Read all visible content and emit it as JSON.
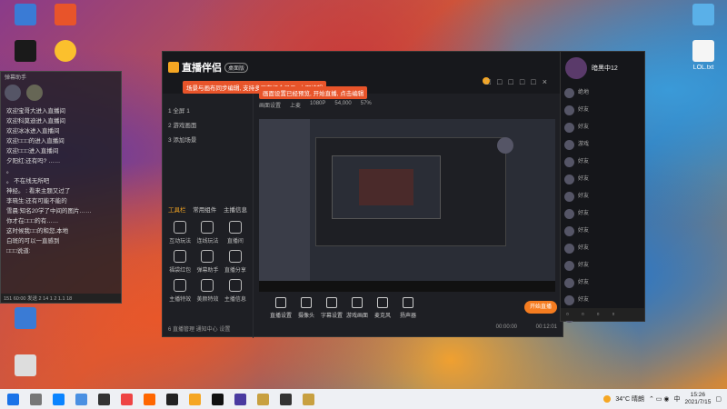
{
  "desktop_icons": [
    {
      "label": "",
      "color": "#3a7bd5"
    },
    {
      "label": "",
      "color": "#e8542a"
    },
    {
      "label": "",
      "color": "#1a1a1a"
    },
    {
      "label": "",
      "color": "#fbc02d"
    },
    {
      "label": "",
      "color": "#888"
    },
    {
      "label": "LOL.txt",
      "color": "#f5f5f5"
    }
  ],
  "chat": {
    "header": "弹幕助手",
    "messages": [
      "欢迎宝哥大进入直播间",
      "欢迎科莫迪进入直播间",
      "欢迎冰冰进入直播间",
      "欢迎□□□的进入直播间",
      "欢迎□□□进入直播间",
      "夕阳红:还有吗? ……",
      "。",
      "。 不在线无所吧",
      "神经。 : 看来主题又过了",
      "李晓生:还有可能不能的",
      "雪晨:知名20学了中间的图片……",
      "你才在□□□的有……",
      "这时候我□□的和您,本地",
      "白斑的可以一直感到",
      "□□□说道:"
    ],
    "footer": "151 60:00 发送 2 14 1 2 1.1 18"
  },
  "app": {
    "title": "直播伴侣",
    "edition": "桌面版",
    "tip1": "场景与画布同步编辑, 支持多画布组合显示, 立即编辑",
    "tip2": "画面设置已经预览, 开始直播, 点击编辑",
    "side_rows": [
      "1 全屏 1",
      "2 游戏画面",
      "3 添加场景"
    ],
    "tabs": [
      "工具栏",
      "常用组件",
      "主播信息"
    ],
    "tools": [
      "互动玩法",
      "连线玩法",
      "直播间",
      "福袋红包",
      "弹幕助手",
      "直播分享",
      "主播特效",
      "美颜特效",
      "主播信息"
    ],
    "bottom_note": "6 直播管理 通知中心 设置",
    "preview_header": [
      "画面设置",
      "上麦",
      "1080P",
      "54,000",
      "57%"
    ],
    "controls": [
      "直播设置",
      "摄像头",
      "字幕设置",
      "游戏画面",
      "麦克风",
      "扬声器",
      "",
      "",
      "",
      ""
    ],
    "start_label": "开始直播",
    "timer": "00:00:00",
    "fps": "00:12:01"
  },
  "right_panel": {
    "username": "暗黑中12",
    "items": [
      "绝地",
      "好友",
      "好友",
      "游戏",
      "好友",
      "好友",
      "好友",
      "好友",
      "好友",
      "好友",
      "好友",
      "好友",
      "好友",
      "好友"
    ]
  },
  "taskbar": {
    "weather": "34°C 晴朗",
    "time": "15:26",
    "date": "2021/7/15",
    "lang": "中"
  }
}
